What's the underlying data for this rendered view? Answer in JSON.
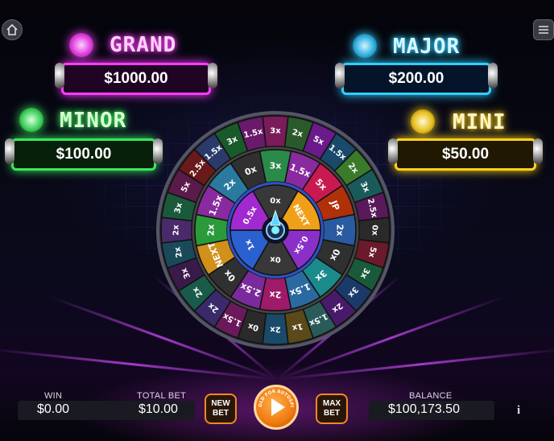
{
  "jackpots": {
    "grand": {
      "label": "GRAND",
      "amount": "$1000.00",
      "color": "#ff3cff"
    },
    "major": {
      "label": "MAJOR",
      "amount": "$200.00",
      "color": "#2fd0ff"
    },
    "minor": {
      "label": "MINOR",
      "amount": "$100.00",
      "color": "#39e85a"
    },
    "mini": {
      "label": "MINI",
      "amount": "$50.00",
      "color": "#ffd21a"
    }
  },
  "wheel": {
    "outer": [
      "3x",
      "2x",
      "5x",
      "1.5x",
      "2x",
      "3x",
      "2.5x",
      "0x",
      "5x",
      "3x",
      "3x",
      "2x",
      "1.5x",
      "1x",
      "2x",
      "0x",
      "1.5x",
      "2x",
      "2x",
      "3x",
      "2x",
      "2x",
      "3x",
      "5x",
      "2.5x",
      "1.5x",
      "3x",
      "1.5x"
    ],
    "outer_fill": [
      "#7a1c5a",
      "#2a5a2a",
      "#6a1a8a",
      "#1a4a6a",
      "#3a7a2a",
      "#1a5a5a",
      "#5a1a5a",
      "#2a2a2a",
      "#6a1a2a",
      "#1a5a3a",
      "#1a3a6a",
      "#4a1a6a",
      "#2a5a5a",
      "#5a4a1a",
      "#1a4a6a",
      "#2a2a2a",
      "#6a1a5a",
      "#3a2a6a",
      "#1a5a4a",
      "#3a1a4a",
      "#1a4a5a",
      "#4a2a6a",
      "#1a5a3a",
      "#5a1a4a",
      "#6a1a1a",
      "#2a3a6a",
      "#1a5a2a",
      "#6a1a6a"
    ],
    "middle": [
      "3x",
      "1.5x",
      "5x",
      "JP",
      "2x",
      "0x",
      "3x",
      "1.5x",
      "2x",
      "2.5x",
      "0x",
      "NEXT",
      "2x",
      "1.5x",
      "2x",
      "0x"
    ],
    "middle_fill": [
      "#2a8a4a",
      "#8a2aa0",
      "#c81a50",
      "#b0300a",
      "#2a5aa0",
      "#303030",
      "#1a8a8a",
      "#2a6aa0",
      "#a01a6a",
      "#7a2a9a",
      "#303030",
      "#d0901a",
      "#2a9a3a",
      "#8a2aa0",
      "#2a7aa0",
      "#303030"
    ],
    "inner": [
      "0x",
      "NEXT",
      "0.5x",
      "0x",
      "1x",
      "0.5x"
    ],
    "inner_fill": [
      "#383838",
      "#f0a018",
      "#8a30c8",
      "#383838",
      "#2a60d0",
      "#a02ad0"
    ]
  },
  "bottom": {
    "win_label": "WIN",
    "win_value": "$0.00",
    "total_bet_label": "TOTAL BET",
    "total_bet_value": "$10.00",
    "new_bet": "NEW BET",
    "max_bet": "MAX BET",
    "spin_caption": "HOLD FOR AUTOSPIN",
    "balance_label": "BALANCE",
    "balance_value": "$100,173.50",
    "info": "i"
  },
  "icons": {
    "home": "home-icon",
    "menu": "menu-icon",
    "spin": "play-icon"
  },
  "colors": {
    "accent": "#f08a1e",
    "background": "#05050c"
  }
}
